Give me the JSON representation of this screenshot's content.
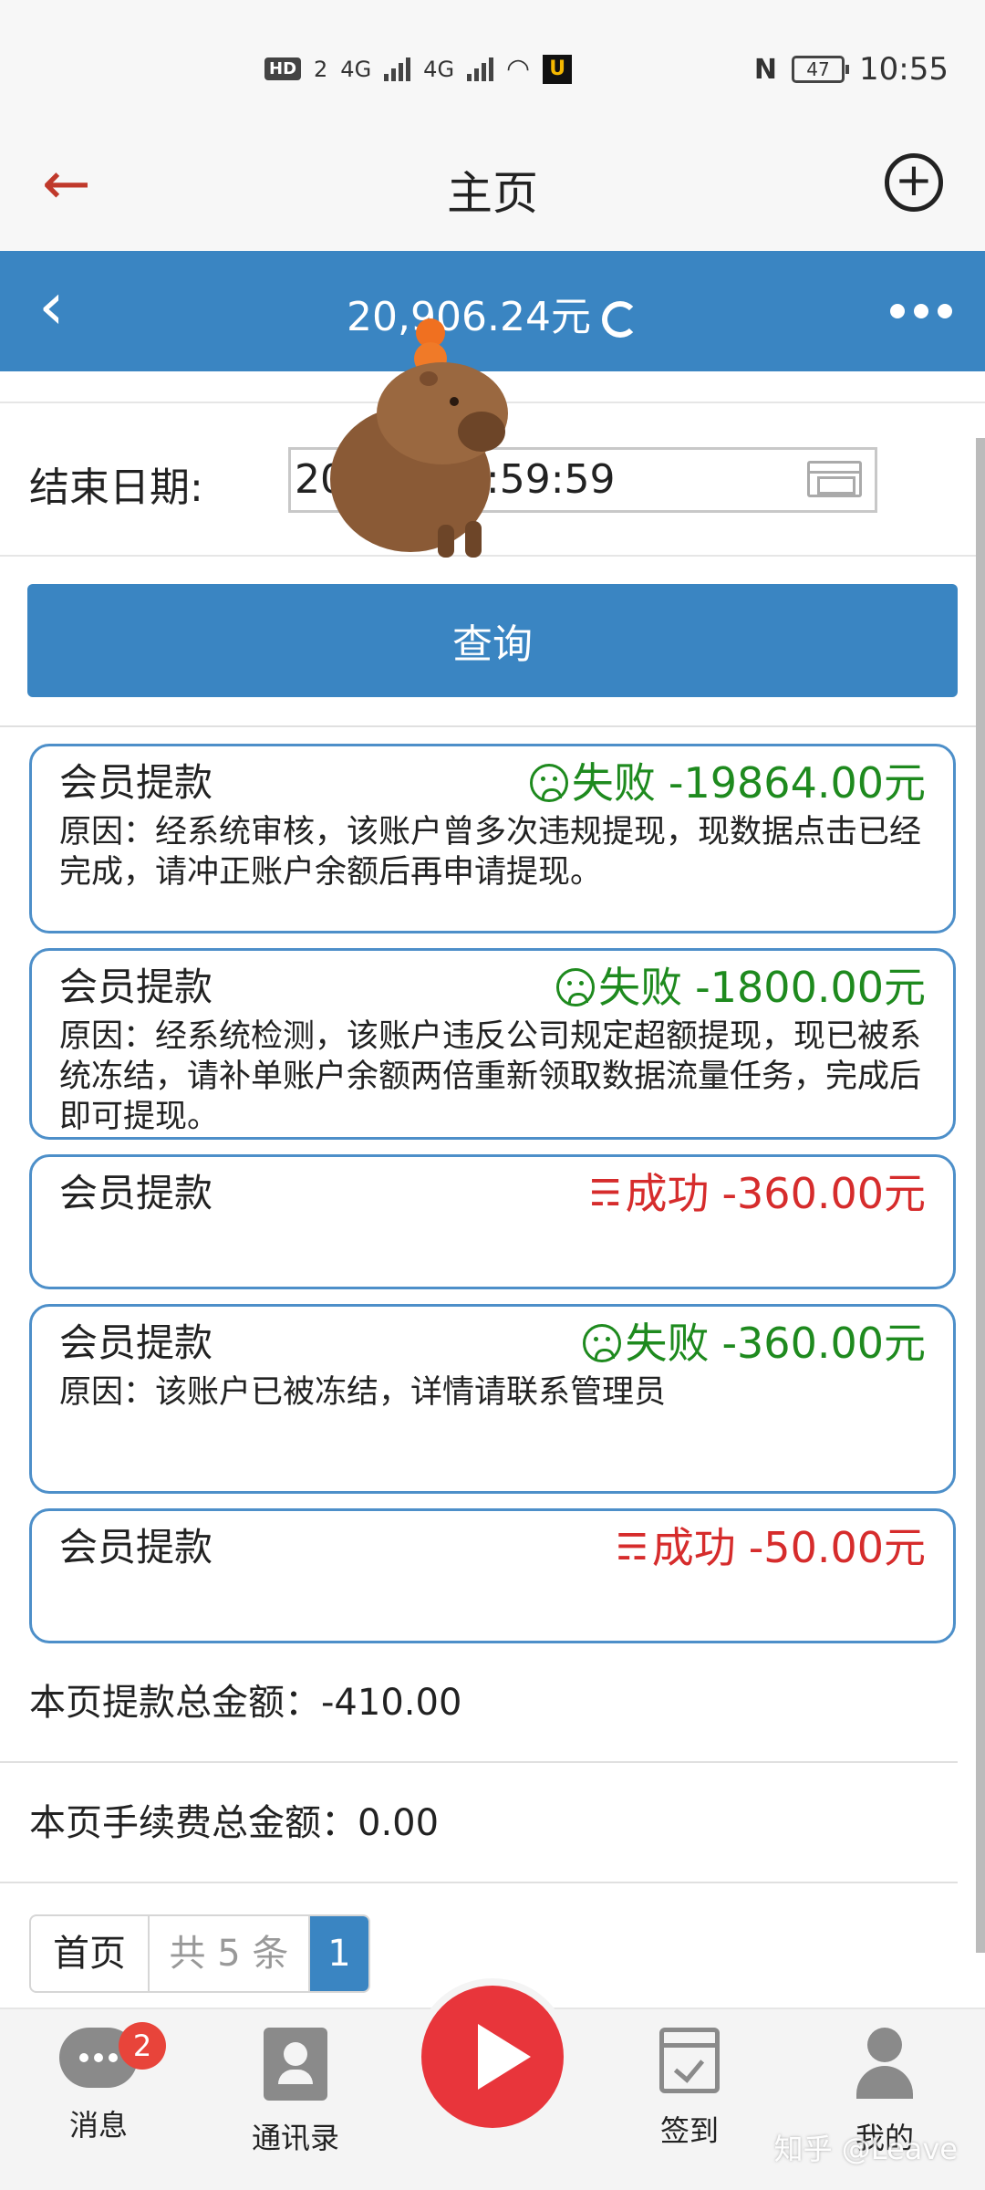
{
  "status_bar": {
    "hd_label": "HD",
    "sim1": "2",
    "net1": "4G",
    "net2": "4G",
    "battery": "47",
    "time": "10:55"
  },
  "nav": {
    "title": "主页"
  },
  "balance_bar": {
    "balance": "20,906.24元"
  },
  "filter": {
    "end_date_label": "结束日期:",
    "end_date_value": "20    2 23:59:59",
    "query_label": "查询"
  },
  "records": [
    {
      "type": "会员提款",
      "status": "失败",
      "amount": "-19864.00元",
      "reason": "原因：经系统审核，该账户曾多次违规提现，现数据点击已经完成，请冲正账户余额后再申请提现。"
    },
    {
      "type": "会员提款",
      "status": "失败",
      "amount": "-1800.00元",
      "reason": "原因：经系统检测，该账户违反公司规定超额提现，现已被系统冻结，请补单账户余额两倍重新领取数据流量任务，完成后即可提现。"
    },
    {
      "type": "会员提款",
      "status": "成功",
      "amount": "-360.00元",
      "reason": ""
    },
    {
      "type": "会员提款",
      "status": "失败",
      "amount": "-360.00元",
      "reason": "原因：该账户已被冻结，详情请联系管理员"
    },
    {
      "type": "会员提款",
      "status": "成功",
      "amount": "-50.00元",
      "reason": ""
    }
  ],
  "summary": {
    "withdraw_total": "本页提款总金额：-410.00",
    "fee_total": "本页手续费总金额：0.00"
  },
  "pager": {
    "first": "首页",
    "total": "共 5 条",
    "current": "1"
  },
  "tabbar": {
    "messages": "消息",
    "messages_badge": "2",
    "contacts": "通讯录",
    "signin": "签到",
    "mine": "我的"
  },
  "watermark": "知乎 @Leave",
  "colors": {
    "primary_blue": "#3a85c2",
    "fail_green": "#1e8a1e",
    "success_red": "#d62c2c",
    "back_arrow": "#c0392b",
    "play_red": "#e8353b"
  }
}
